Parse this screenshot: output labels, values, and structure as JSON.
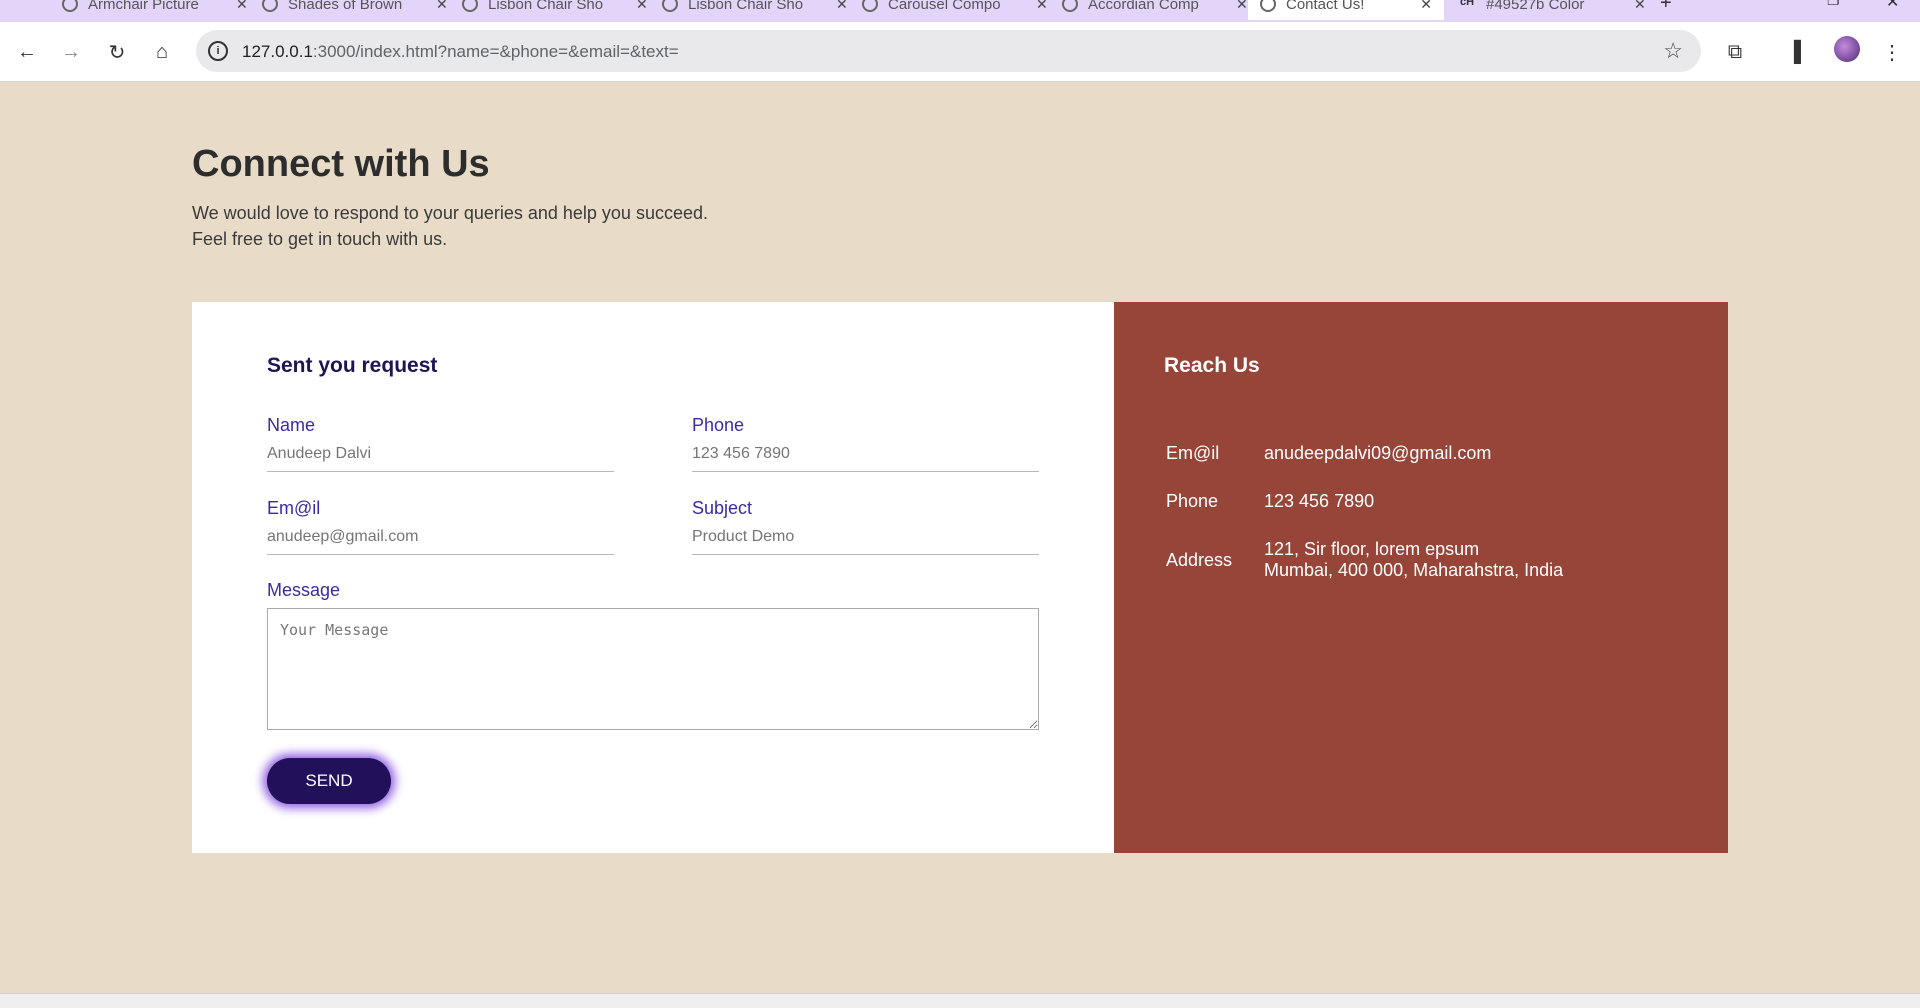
{
  "browser": {
    "tabs": [
      {
        "title": "Armchair Picture"
      },
      {
        "title": "Shades of Brown"
      },
      {
        "title": "Lisbon Chair Sho"
      },
      {
        "title": "Lisbon Chair Sho"
      },
      {
        "title": "Carousel Compo"
      },
      {
        "title": "Accordian Comp"
      },
      {
        "title": "Contact Us!"
      },
      {
        "title": "#49527b Color"
      }
    ],
    "url_host": "127.0.0.1",
    "url_rest": ":3000/index.html?name=&phone=&email=&text="
  },
  "page": {
    "title": "Connect with Us",
    "subtitle_line1": "We would love to respond to your queries and help you succeed.",
    "subtitle_line2": "Feel free to get in touch with us."
  },
  "form": {
    "title": "Sent you request",
    "name_label": "Name",
    "name_placeholder": "Anudeep Dalvi",
    "phone_label": "Phone",
    "phone_placeholder": "123 456 7890",
    "email_label": "Em@il",
    "email_placeholder": "anudeep@gmail.com",
    "subject_label": "Subject",
    "subject_placeholder": "Product Demo",
    "message_label": "Message",
    "message_placeholder": "Your Message",
    "send_label": "SEND"
  },
  "reach": {
    "title": "Reach Us",
    "email_key": "Em@il",
    "email_value": "anudeepdalvi09@gmail.com",
    "phone_key": "Phone",
    "phone_value": "123 456 7890",
    "address_key": "Address",
    "address_line1": "121, Sir floor, lorem epsum",
    "address_line2": "Mumbai, 400 000, Maharahstra, India"
  },
  "colors": {
    "page_bg": "#e8dcc8",
    "panel_bg": "#964538",
    "label_color": "#3b2aa3",
    "button_bg": "#22105a",
    "tabstrip_bg": "#e3d4fa"
  }
}
